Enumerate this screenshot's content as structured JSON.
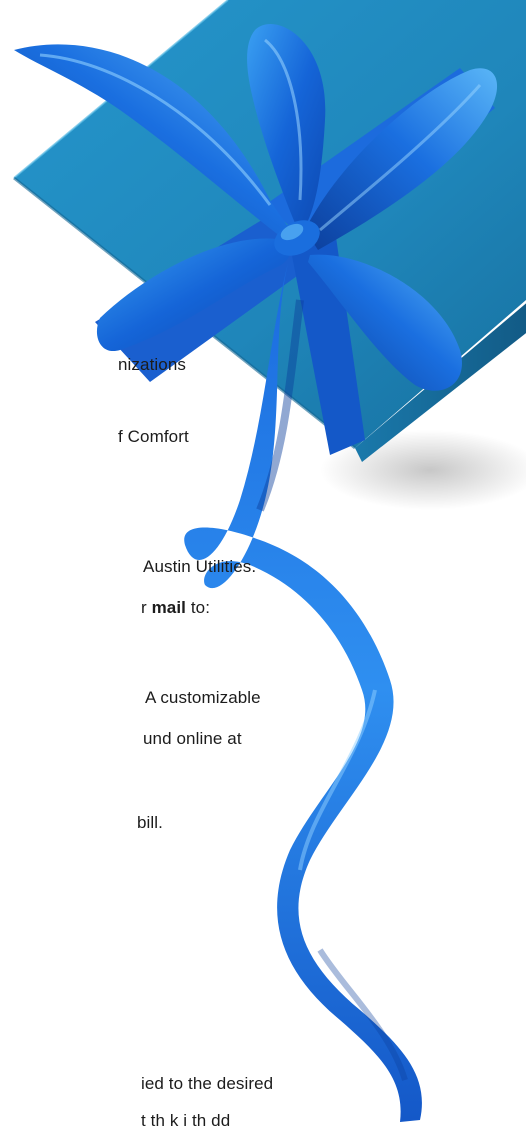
{
  "text_lines": {
    "line1": "nizations",
    "line2": "f Comfort",
    "line3": "Austin Utilities.",
    "line4_before": "r ",
    "line4_bold": "mail",
    "line4_after": " to:",
    "line5": "A customizable",
    "line6": "und online at",
    "line7": "bill.",
    "line8": "ied to the desired",
    "line9": "t th          k  i  th    dd"
  },
  "colors": {
    "background": "#ffffff",
    "box_top": "#2a8fc4",
    "box_side": "#1a6fa0",
    "ribbon": "#1565d8",
    "ribbon_light": "#4aa8f5",
    "ribbon_dark": "#0d3f9e",
    "text": "#1c1c1c"
  },
  "image": {
    "subject": "gift-box-with-blue-ribbon-bow"
  }
}
